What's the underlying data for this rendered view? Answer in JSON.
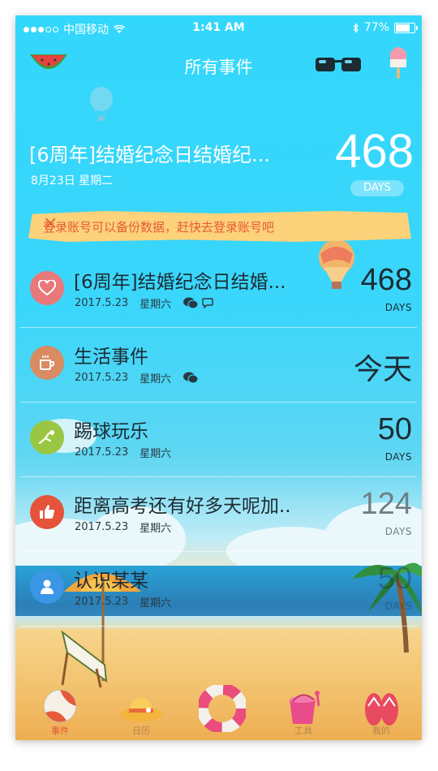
{
  "status": {
    "carrier": "中国移动",
    "time": "1:41 AM",
    "battery": "77%",
    "battery_level": 0.77
  },
  "header": {
    "title": "所有事件"
  },
  "hero": {
    "title": "[6周年]结婚纪念日结婚纪...",
    "date": "8月23日  星期二",
    "number": "468",
    "unit": "DAYS"
  },
  "banner": {
    "text": "登录账号可以备份数据，赶快去登录账号吧",
    "close": "×"
  },
  "events": [
    {
      "title": "[6周年]结婚纪念日结婚...",
      "date": "2017.5.23",
      "weekday": "星期六",
      "number": "468",
      "unit": "DAYS",
      "color": "#e9787a",
      "icon": "heart-icon"
    },
    {
      "title": "生活事件",
      "date": "2017.5.23",
      "weekday": "星期六",
      "today": "今天",
      "color": "#d98b62",
      "icon": "coffee-cup-icon"
    },
    {
      "title": "踢球玩乐",
      "date": "2017.5.23",
      "weekday": "星期六",
      "number": "50",
      "unit": "DAYS",
      "color": "#9ac641",
      "icon": "kick-ball-icon"
    },
    {
      "title": "距离高考还有好多天呢加..",
      "date": "2017.5.23",
      "weekday": "星期六",
      "number": "124",
      "unit": "DAYS",
      "color": "#e5533a",
      "icon": "thumbs-up-icon"
    },
    {
      "title": "认识某某",
      "date": "2017.5.23",
      "weekday": "星期六",
      "number": "50",
      "unit": "DAYS",
      "color": "#3b96e6",
      "icon": "person-icon"
    }
  ],
  "tabs": [
    {
      "label": "事件",
      "active": true
    },
    {
      "label": "日历"
    },
    {
      "label": ""
    },
    {
      "label": "工具"
    },
    {
      "label": "我的"
    }
  ]
}
